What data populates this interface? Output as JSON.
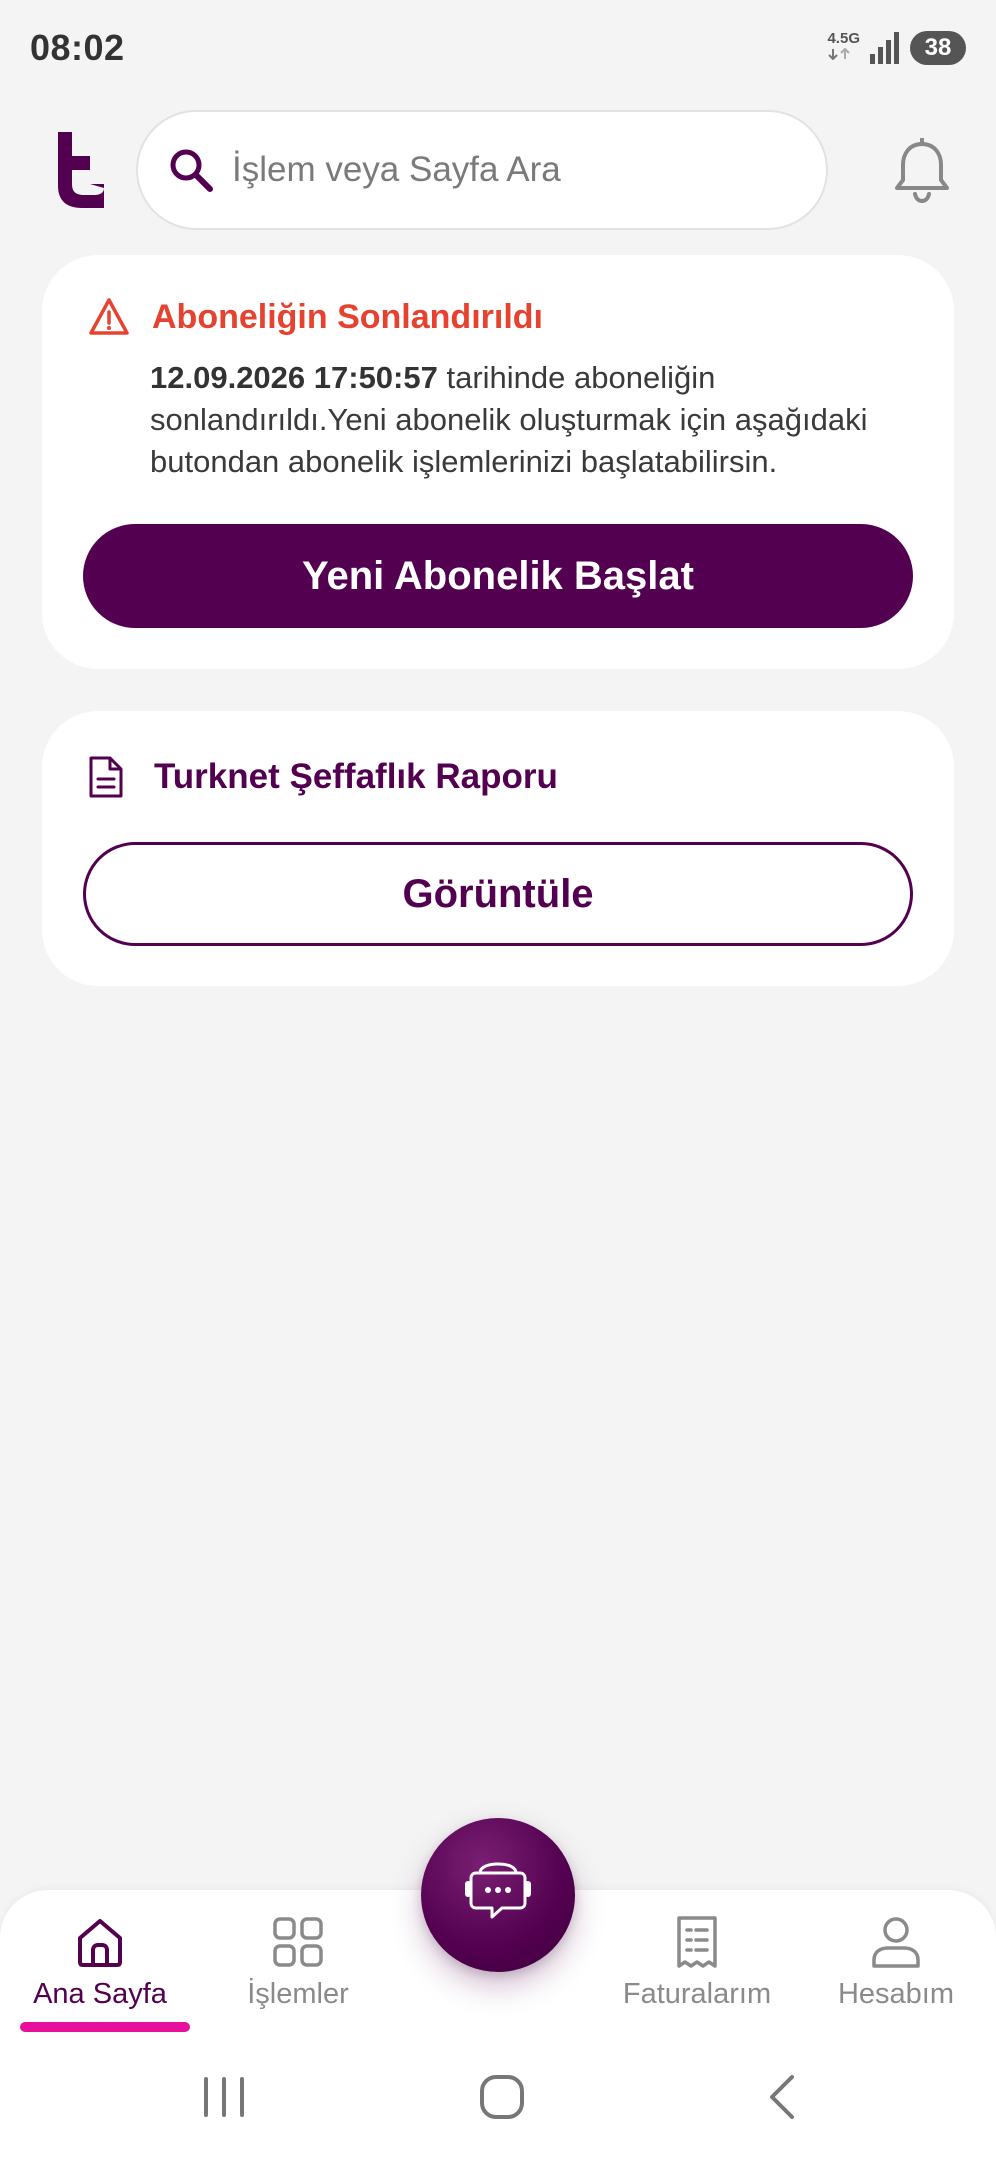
{
  "status_bar": {
    "time": "08:02",
    "network_type": "4.5G",
    "battery_level": "38",
    "icons": [
      "signal-icon",
      "battery-icon"
    ]
  },
  "header": {
    "logo_icon": "turknet-logo-icon",
    "search_placeholder": "İşlem veya Sayfa Ara",
    "search_icon": "search-icon",
    "notification_icon": "bell-icon"
  },
  "alert_card": {
    "icon": "warning-icon",
    "title": "Aboneliğin Sonlandırıldı",
    "date_text": "12.09.2026 17:50:57",
    "body_line1_rest": " tarihinde aboneliğin",
    "body_line2": "sonlandırıldı.Yeni abonelik oluşturmak için aşağıdaki",
    "body_line3": "butondan abonelik işlemlerinizi başlatabilirsin.",
    "button_label": "Yeni Abonelik Başlat"
  },
  "report_card": {
    "icon": "document-icon",
    "title": "Turknet Şeffaflık Raporu",
    "button_label": "Görüntüle"
  },
  "bottom_nav": {
    "items": [
      {
        "label": "Ana Sayfa",
        "icon": "home-icon",
        "active": true
      },
      {
        "label": "İşlemler",
        "icon": "grid-icon",
        "active": false
      },
      {
        "label": "Faturalarım",
        "icon": "receipt-icon",
        "active": false
      },
      {
        "label": "Hesabım",
        "icon": "user-icon",
        "active": false
      }
    ],
    "chat_icon": "chat-support-icon"
  },
  "colors": {
    "brand": "#52004f",
    "alert": "#e5432f",
    "active_indicator": "#e6109b",
    "background": "#f4f4f4"
  }
}
